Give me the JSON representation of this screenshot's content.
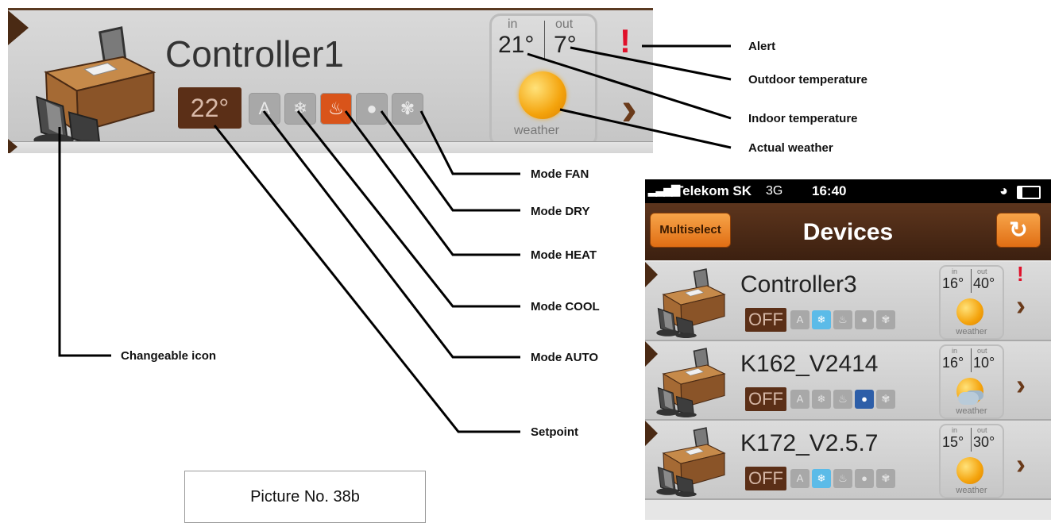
{
  "zoom_row": {
    "title": "Controller1",
    "setpoint": "22°",
    "weather": {
      "in_label": "in",
      "out_label": "out",
      "in_temp": "21°",
      "out_temp": "7°",
      "label": "weather"
    },
    "modes": [
      {
        "name": "auto",
        "glyph": "A",
        "active": false
      },
      {
        "name": "cool",
        "glyph": "❄",
        "active": false
      },
      {
        "name": "heat",
        "glyph": "♨",
        "active": true
      },
      {
        "name": "dry",
        "glyph": "●",
        "active": false
      },
      {
        "name": "fan",
        "glyph": "✾",
        "active": false
      }
    ],
    "alert_glyph": "!",
    "next_glyph": "›"
  },
  "callouts": {
    "alert": "Alert",
    "outdoor": "Outdoor temperature",
    "indoor": "Indoor temperature",
    "weather": "Actual weather",
    "fan": "Mode FAN",
    "dry": "Mode DRY",
    "heat": "Mode HEAT",
    "cool": "Mode COOL",
    "auto": "Mode AUTO",
    "setpoint": "Setpoint",
    "icon": "Changeable icon"
  },
  "caption": "Picture No. 38b",
  "phone": {
    "status": {
      "carrier": "Telekom SK",
      "network": "3G",
      "time": "16:40"
    },
    "nav": {
      "left_button": "Multiselect",
      "title": "Devices",
      "refresh_glyph": "↻"
    },
    "rows": [
      {
        "name": "Controller3",
        "off": "OFF",
        "in_label": "in",
        "out_label": "out",
        "in_temp": "16°",
        "out_temp": "40°",
        "weather_label": "weather",
        "alert": "!",
        "chevron": "›",
        "active_mode": "cool",
        "weather_icon": "sun"
      },
      {
        "name": "K162_V2414",
        "off": "OFF",
        "in_label": "in",
        "out_label": "out",
        "in_temp": "16°",
        "out_temp": "10°",
        "weather_label": "weather",
        "alert": "",
        "chevron": "›",
        "active_mode": "dry",
        "weather_icon": "sun-cloud"
      },
      {
        "name": "K172_V2.5.7",
        "off": "OFF",
        "in_label": "in",
        "out_label": "out",
        "in_temp": "15°",
        "out_temp": "30°",
        "weather_label": "weather",
        "alert": "",
        "chevron": "›",
        "active_mode": "cool",
        "weather_icon": "sun"
      }
    ]
  }
}
